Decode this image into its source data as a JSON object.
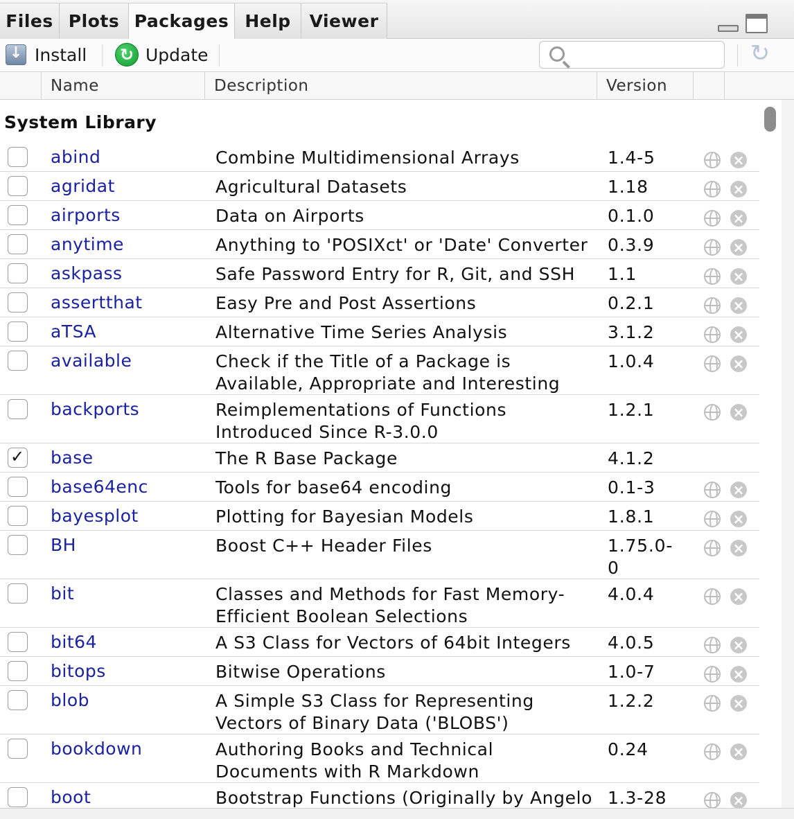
{
  "tabs": [
    {
      "label": "Files"
    },
    {
      "label": "Plots"
    },
    {
      "label": "Packages"
    },
    {
      "label": "Help"
    },
    {
      "label": "Viewer"
    }
  ],
  "active_tab": "Packages",
  "toolbar": {
    "install_label": "Install",
    "update_label": "Update",
    "search_placeholder": ""
  },
  "columns": {
    "name": "Name",
    "description": "Description",
    "version": "Version"
  },
  "library_title": "System Library",
  "packages": [
    {
      "name": "abind",
      "description": "Combine Multidimensional Arrays",
      "version": "1.4-5",
      "checked": false
    },
    {
      "name": "agridat",
      "description": "Agricultural Datasets",
      "version": "1.18",
      "checked": false
    },
    {
      "name": "airports",
      "description": "Data on Airports",
      "version": "0.1.0",
      "checked": false
    },
    {
      "name": "anytime",
      "description": "Anything to 'POSIXct' or 'Date' Converter",
      "version": "0.3.9",
      "checked": false
    },
    {
      "name": "askpass",
      "description": "Safe Password Entry for R, Git, and SSH",
      "version": "1.1",
      "checked": false
    },
    {
      "name": "assertthat",
      "description": "Easy Pre and Post Assertions",
      "version": "0.2.1",
      "checked": false
    },
    {
      "name": "aTSA",
      "description": "Alternative Time Series Analysis",
      "version": "3.1.2",
      "checked": false
    },
    {
      "name": "available",
      "description": "Check if the Title of a Package is Available, Appropriate and Interesting",
      "version": "1.0.4",
      "checked": false
    },
    {
      "name": "backports",
      "description": "Reimplementations of Functions Introduced Since R-3.0.0",
      "version": "1.2.1",
      "checked": false
    },
    {
      "name": "base",
      "description": "The R Base Package",
      "version": "4.1.2",
      "checked": true
    },
    {
      "name": "base64enc",
      "description": "Tools for base64 encoding",
      "version": "0.1-3",
      "checked": false
    },
    {
      "name": "bayesplot",
      "description": "Plotting for Bayesian Models",
      "version": "1.8.1",
      "checked": false
    },
    {
      "name": "BH",
      "description": "Boost C++ Header Files",
      "version": "1.75.0-0",
      "checked": false
    },
    {
      "name": "bit",
      "description": "Classes and Methods for Fast Memory-Efficient Boolean Selections",
      "version": "4.0.4",
      "checked": false
    },
    {
      "name": "bit64",
      "description": "A S3 Class for Vectors of 64bit Integers",
      "version": "4.0.5",
      "checked": false
    },
    {
      "name": "bitops",
      "description": "Bitwise Operations",
      "version": "1.0-7",
      "checked": false
    },
    {
      "name": "blob",
      "description": "A Simple S3 Class for Representing Vectors of Binary Data ('BLOBS')",
      "version": "1.2.2",
      "checked": false
    },
    {
      "name": "bookdown",
      "description": "Authoring Books and Technical Documents with R Markdown",
      "version": "0.24",
      "checked": false
    },
    {
      "name": "boot",
      "description": "Bootstrap Functions (Originally by Angelo",
      "version": "1.3-28",
      "checked": false
    }
  ]
}
